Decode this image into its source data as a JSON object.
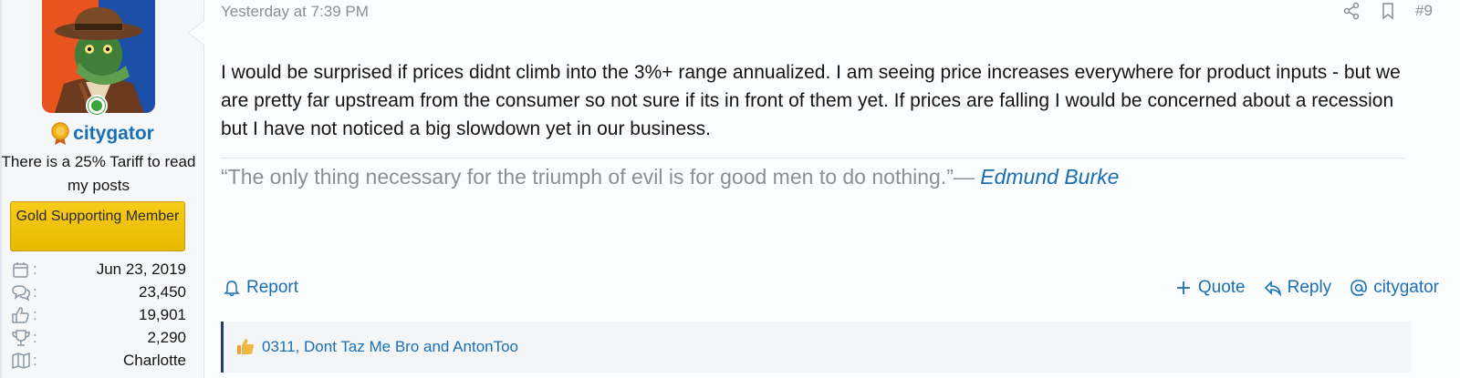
{
  "user": {
    "username": "citygator",
    "title": "There is a 25% Tariff to read my posts",
    "banner": "Gold Supporting Member",
    "stats": [
      {
        "icon": "calendar-icon",
        "value": "Jun 23, 2019"
      },
      {
        "icon": "messages-icon",
        "value": "23,450"
      },
      {
        "icon": "thumbs-up-icon",
        "value": "19,901"
      },
      {
        "icon": "trophy-icon",
        "value": "2,290"
      },
      {
        "icon": "map-icon",
        "value": "Charlotte"
      }
    ]
  },
  "post": {
    "timestamp": "Yesterday at 7:39 PM",
    "number": "#9",
    "body": "I would be surprised if prices didnt climb into the 3%+ range annualized. I am seeing price increases everywhere for product inputs - but we are pretty far upstream from the consumer so not sure if its in front of them yet. If prices are falling I would be concerned about a recession but I have not noticed a big slowdown yet in our business.",
    "signature_quote": "“The only thing necessary for the triumph of evil is for good men to do nothing.”—",
    "signature_author": "Edmund Burke"
  },
  "actions": {
    "report": "Report",
    "quote": "Quote",
    "reply": "Reply",
    "mention": "citygator"
  },
  "reactions": {
    "icon": "thumbs-up-icon",
    "users": "0311, Dont Taz Me Bro and AntonToo"
  },
  "colors": {
    "link": "#1a6fb3",
    "banner": "#f2c40f",
    "online": "#3aa53a",
    "muted": "#8a8f96"
  }
}
